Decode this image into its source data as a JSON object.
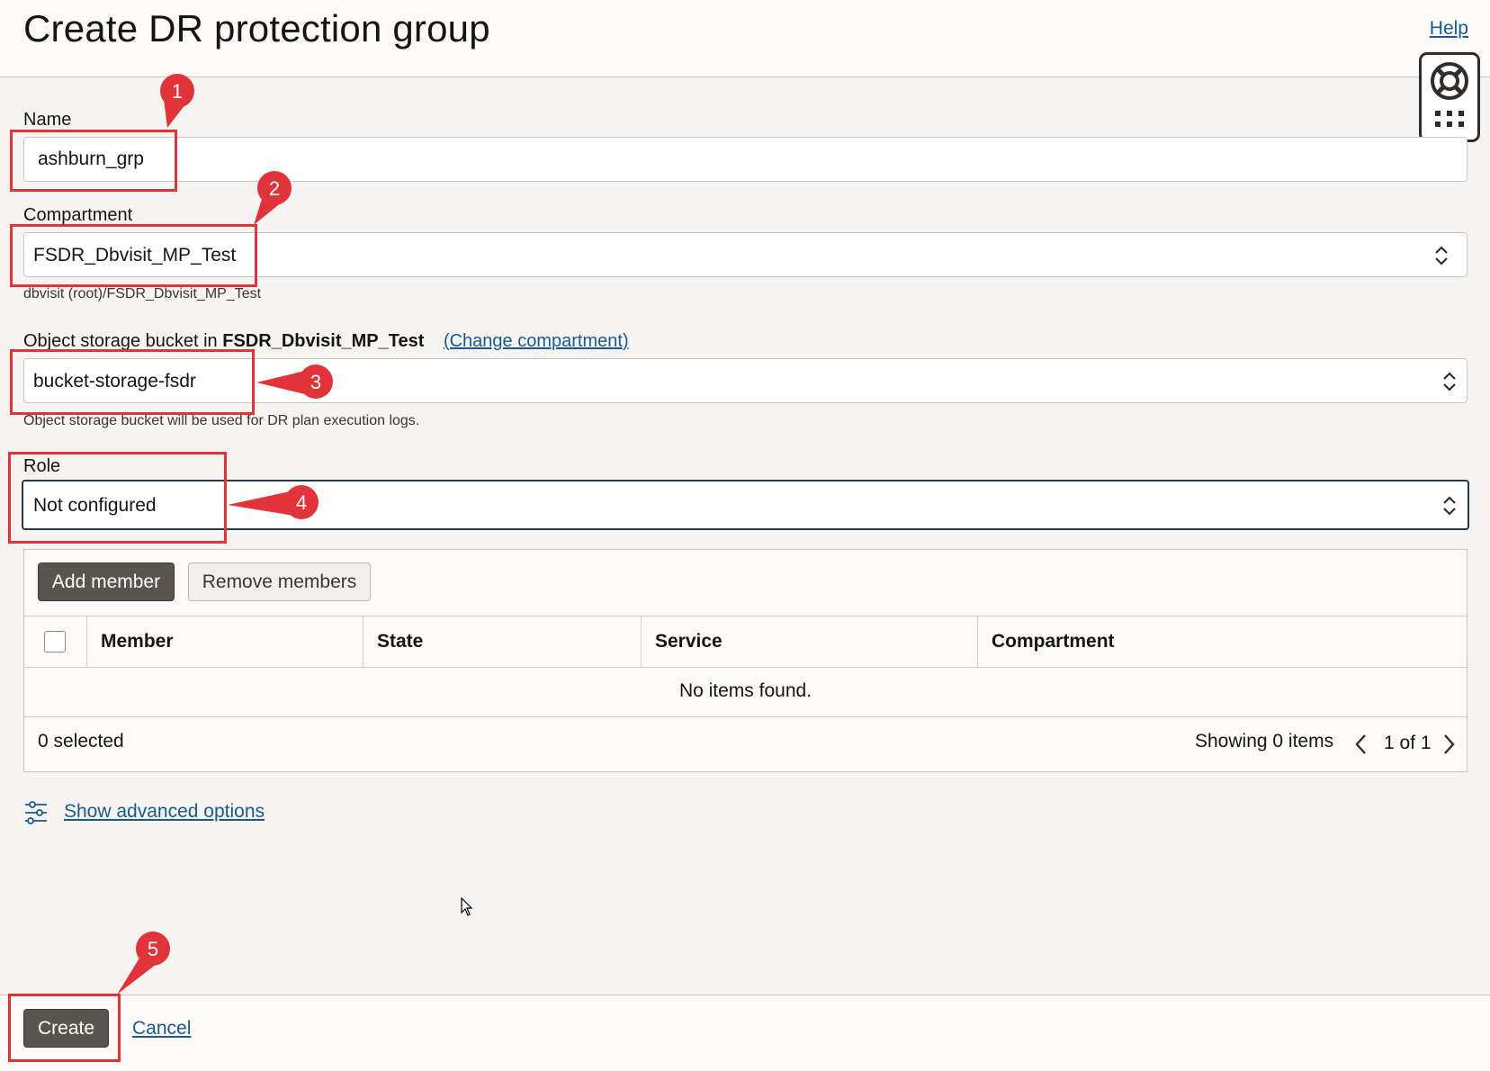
{
  "header": {
    "title": "Create DR protection group",
    "help_label": "Help"
  },
  "form": {
    "name": {
      "label": "Name",
      "value": "ashburn_grp"
    },
    "compartment": {
      "label": "Compartment",
      "value": "FSDR_Dbvisit_MP_Test",
      "path": "dbvisit (root)/FSDR_Dbvisit_MP_Test"
    },
    "bucket": {
      "label_prefix": "Object storage bucket in",
      "label_compartment": "FSDR_Dbvisit_MP_Test",
      "change_link": "(Change compartment)",
      "value": "bucket-storage-fsdr",
      "help": "Object storage bucket will be used for DR plan execution logs."
    },
    "role": {
      "label": "Role",
      "value": "Not configured"
    }
  },
  "members": {
    "add_button": "Add member",
    "remove_button": "Remove members",
    "columns": [
      "Member",
      "State",
      "Service",
      "Compartment"
    ],
    "empty_message": "No items found.",
    "selected_count": "0 selected",
    "showing": "Showing 0 items",
    "pagination": "1 of 1"
  },
  "advanced_link": "Show advanced options",
  "footer": {
    "create_button": "Create",
    "cancel_link": "Cancel"
  },
  "annotations": [
    "1",
    "2",
    "3",
    "4",
    "5"
  ],
  "colors": {
    "annotation_red": "#e0333a",
    "link_blue": "#1a5a8c",
    "primary_button": "#5a544e",
    "focus_border": "#1f3b4d"
  }
}
